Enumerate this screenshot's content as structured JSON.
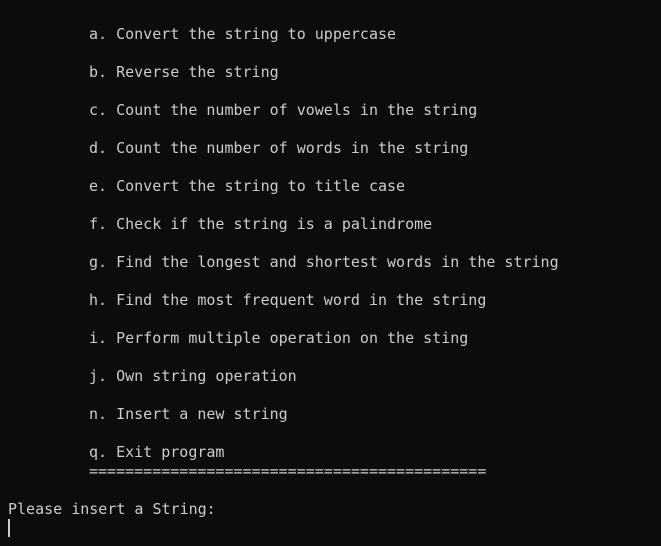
{
  "menu": {
    "items": [
      "a. Convert the string to uppercase",
      "b. Reverse the string",
      "c. Count the number of vowels in the string",
      "d. Count the number of words in the string",
      "e. Convert the string to title case",
      "f. Check if the string is a palindrome",
      "g. Find the longest and shortest words in the string",
      "h. Find the most frequent word in the string",
      "i. Perform multiple operation on the sting",
      "j. Own string operation",
      "n. Insert a new string",
      "q. Exit program"
    ],
    "separator": "============================================"
  },
  "prompt": {
    "text": "Please insert a String:"
  },
  "colors": {
    "background": "#0c0c0c",
    "foreground": "#cccccc"
  }
}
